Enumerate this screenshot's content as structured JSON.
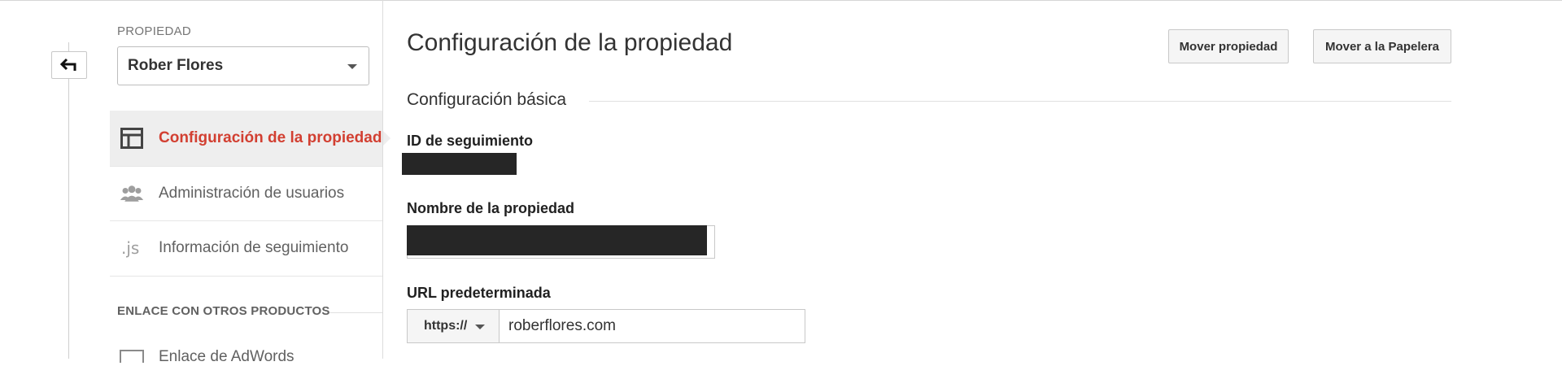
{
  "sidebar": {
    "property_label": "PROPIEDAD",
    "property_selected": "Rober Flores",
    "items": [
      {
        "label": "Configuración de la propiedad",
        "active": true,
        "icon": "layout-icon"
      },
      {
        "label": "Administración de usuarios",
        "active": false,
        "icon": "users-icon"
      },
      {
        "label": "Información de seguimiento",
        "active": false,
        "icon": "js-icon"
      }
    ],
    "section_title": "ENLACE CON OTROS PRODUCTOS",
    "partial_item": "Enlace de AdWords"
  },
  "main": {
    "title": "Configuración de la propiedad",
    "move_button": "Mover propiedad",
    "trash_button": "Mover a la Papelera",
    "section": "Configuración básica",
    "tracking_id_label": "ID de seguimiento",
    "property_name_label": "Nombre de la propiedad",
    "default_url_label": "URL predeterminada",
    "protocol": "https://",
    "url_value": "roberflores.com"
  },
  "colors": {
    "accent": "#d23f31",
    "active_bg": "#eeeeee",
    "redaction": "#262626"
  }
}
